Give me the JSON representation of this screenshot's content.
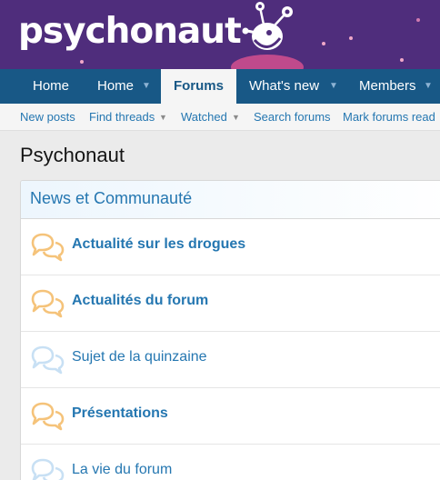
{
  "header": {
    "logo_text": "psychonaut"
  },
  "nav": {
    "tabs": [
      {
        "label": "Home",
        "has_menu": false
      },
      {
        "label": "Home",
        "has_menu": true
      },
      {
        "label": "Forums",
        "has_menu": false,
        "active": true
      },
      {
        "label": "What's new",
        "has_menu": true
      },
      {
        "label": "Members",
        "has_menu": true
      }
    ]
  },
  "subnav": {
    "items": [
      {
        "label": "New posts",
        "has_menu": false
      },
      {
        "label": "Find threads",
        "has_menu": true
      },
      {
        "label": "Watched",
        "has_menu": true
      },
      {
        "label": "Search forums",
        "has_menu": false
      },
      {
        "label": "Mark forums read",
        "has_menu": false
      }
    ]
  },
  "page": {
    "title": "Psychonaut"
  },
  "category": {
    "title": "News et Communauté",
    "forums": [
      {
        "title": "Actualité sur les drogues",
        "unread": true,
        "icon": "chat-bubbles-icon"
      },
      {
        "title": "Actualités du forum",
        "unread": true,
        "icon": "chat-bubbles-icon"
      },
      {
        "title": "Sujet de la quinzaine",
        "unread": false,
        "icon": "chat-bubbles-icon"
      },
      {
        "title": "Présentations",
        "unread": true,
        "icon": "chat-bubbles-icon"
      },
      {
        "title": "La vie du forum",
        "unread": false,
        "icon": "chat-bubbles-icon"
      }
    ]
  },
  "colors": {
    "header_bg": "#4f2d7c",
    "nav_bg": "#185886",
    "link": "#2577b1",
    "unread_icon": "#f5c37a",
    "read_icon": "#c8e0f4",
    "mascot_pink": "#c04a8c"
  }
}
